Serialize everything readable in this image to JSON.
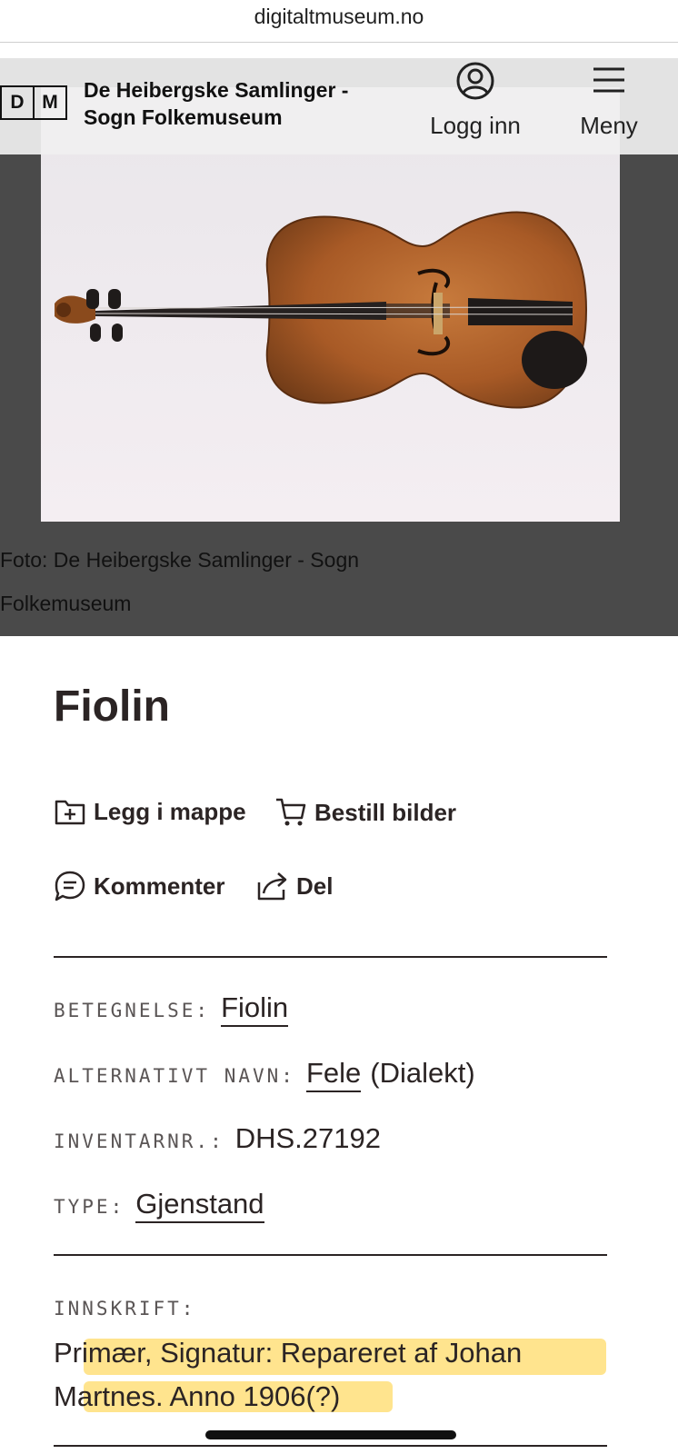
{
  "browser": {
    "url": "digitaltmuseum.no"
  },
  "site": {
    "logo_left": "D",
    "logo_right": "M",
    "museum_line1": "De Heibergske Samlinger -",
    "museum_line2": "Sogn Folkemuseum",
    "login_label": "Logg inn",
    "menu_label": "Meny"
  },
  "photo": {
    "caption": "Foto: De Heibergske Samlinger - Sogn Folkemuseum"
  },
  "object": {
    "title": "Fiolin"
  },
  "actions": {
    "folder": "Legg i mappe",
    "order": "Bestill bilder",
    "comment": "Kommenter",
    "share": "Del"
  },
  "fields": {
    "betegnelse_label": "BETEGNELSE:",
    "betegnelse_value": "Fiolin",
    "alt_name_label": "ALTERNATIVT NAVN:",
    "alt_name_value": "Fele",
    "alt_name_note": "(Dialekt)",
    "inventory_label": "INVENTARNR.:",
    "inventory_value": "DHS.27192",
    "type_label": "TYPE:",
    "type_value": "Gjenstand",
    "inscription_label": "INNSKRIFT:",
    "inscription_value": "Primær, Signatur: Repareret af Johan Martnes. Anno 1906(?)"
  },
  "colors": {
    "text": "#2b2424",
    "hero_bg": "#4a4a4a",
    "highlight": "#ffcd32"
  }
}
